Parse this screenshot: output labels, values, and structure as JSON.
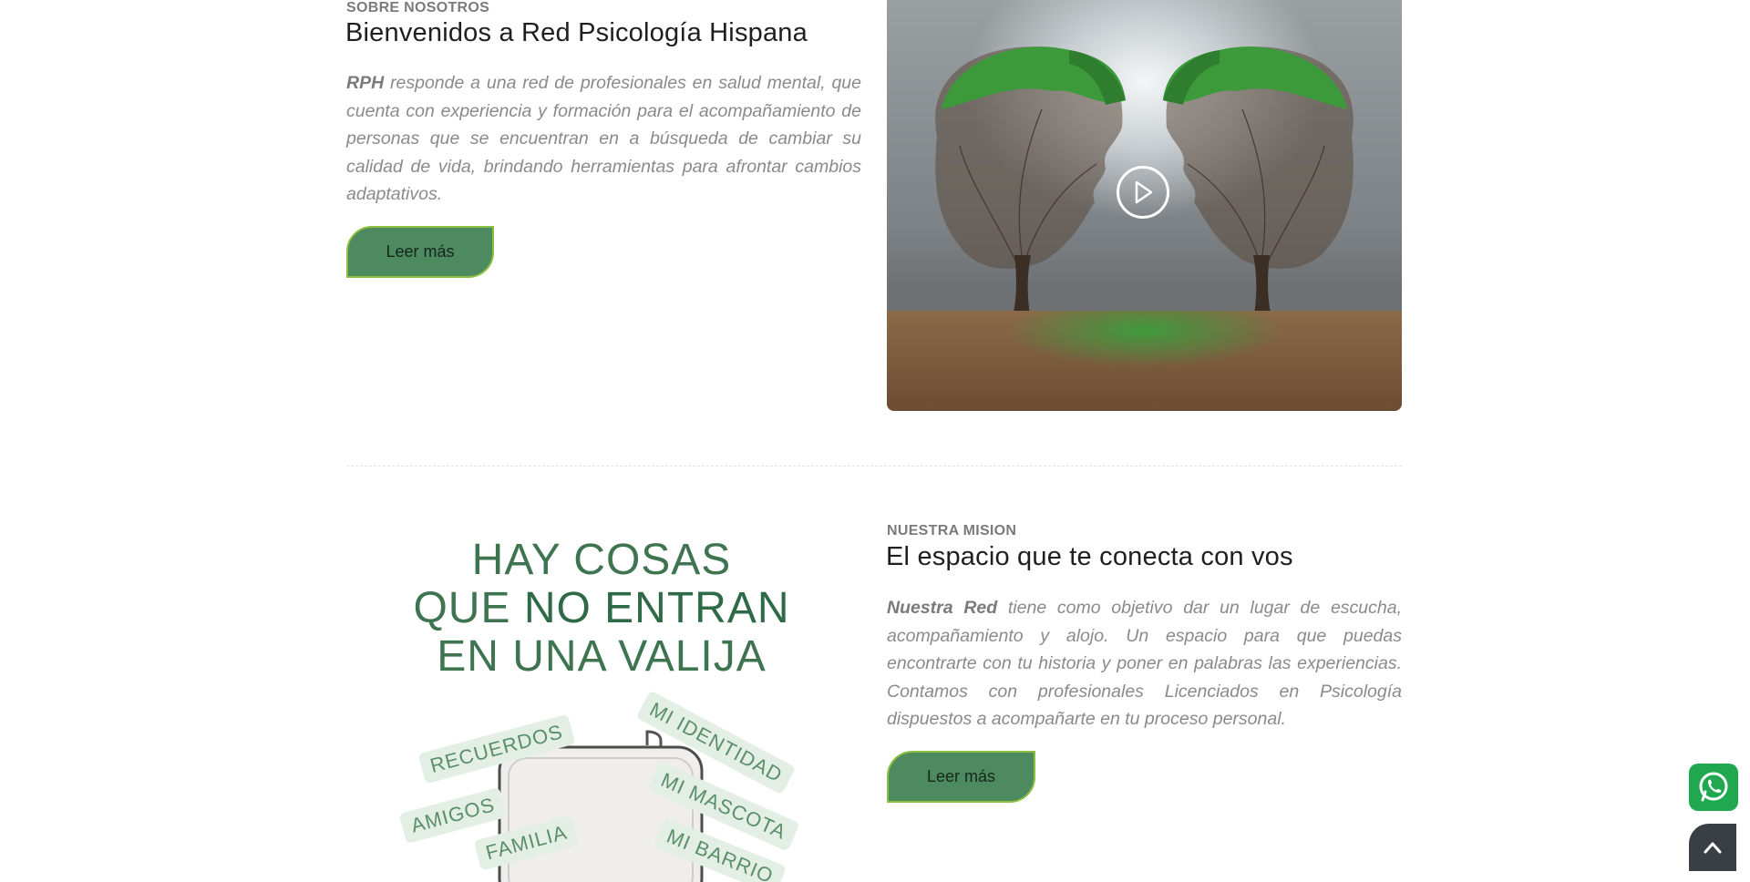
{
  "about": {
    "eyebrow": "SOBRE NOSOTROS",
    "heading": "Bienvenidos a Red Psicología Hispana",
    "lead_bold": "RPH",
    "body": " responde a una red de profesionales en salud mental, que cuenta con experiencia y formación para el acompañamiento de personas que se encuentran en a búsqueda de cambiar su calidad de vida, brindando herramientas para afrontar cambios adaptativos.",
    "button_label": "Leer más"
  },
  "mission": {
    "eyebrow": "NUESTRA MISION",
    "heading": "El espacio que te conecta con vos",
    "lead_bold": "Nuestra Red",
    "body": " tiene como objetivo dar un lugar de escucha, acompañamiento y alojo. Un espacio para que puedas encontrarte con tu historia y poner en palabras las experiencias. Contamos con profesionales Licenciados en Psicología dispuestos a acompañarte en tu proceso personal.",
    "button_label": "Leer más"
  },
  "illustration": {
    "line1": "HAY COSAS",
    "line2_a": "QUE ",
    "line2_b": "NO ENTRAN",
    "line3": "EN UNA VALIJA",
    "tags": [
      "RECUERDOS",
      "MI IDENTIDAD",
      "MI MASCOTA",
      "AMIGOS",
      "FAMILIA",
      "MI BARRIO"
    ]
  },
  "colors": {
    "brand_green": "#4e8a5f",
    "button_border": "#8bbf3f",
    "whatsapp": "#1fa84f"
  },
  "icons": {
    "video": "play-icon",
    "chat": "whatsapp-icon",
    "scroll": "chevron-up-icon"
  }
}
